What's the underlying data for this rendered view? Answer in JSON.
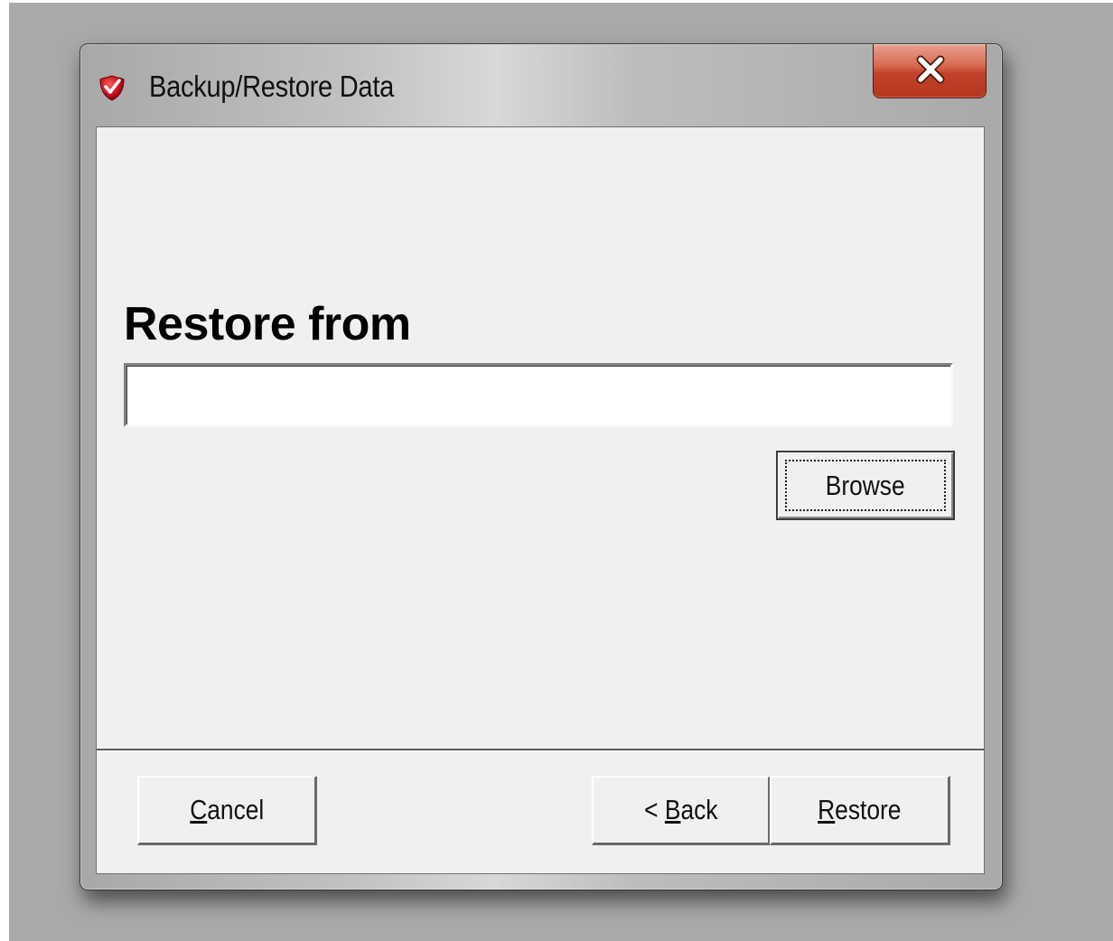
{
  "window": {
    "title": "Backup/Restore Data",
    "icon": "shield-check-icon",
    "close_icon": "close-icon"
  },
  "restore": {
    "heading": "Restore from",
    "path_value": "",
    "browse_label": "Browse"
  },
  "footer": {
    "cancel_label_underlined": "C",
    "cancel_label_rest": "ancel",
    "back_label_prefix": "< ",
    "back_label_underlined": "B",
    "back_label_rest": "ack",
    "restore_label_underlined": "R",
    "restore_label_rest": "estore"
  },
  "colors": {
    "client_background": "#f0f0f0",
    "close_button": "#c1412a",
    "icon_red": "#c8101e"
  }
}
